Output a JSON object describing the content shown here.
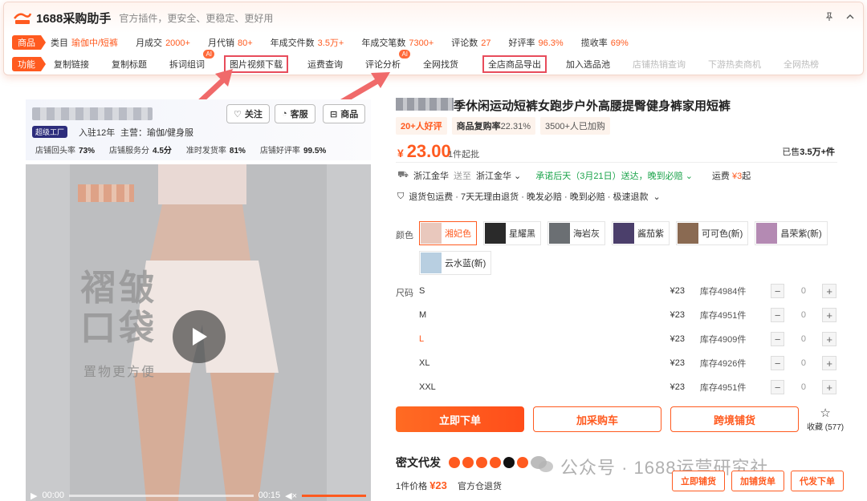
{
  "plugin": {
    "app_name": "1688采购助手",
    "tagline": "官方插件，更安全、更稳定、更好用",
    "row1_tag": "商品",
    "stats": [
      {
        "label": "类目",
        "value": "瑜伽中/短裤"
      },
      {
        "label": "月成交",
        "value": "2000+"
      },
      {
        "label": "月代销",
        "value": "80+"
      },
      {
        "label": "年成交件数",
        "value": "3.5万+"
      },
      {
        "label": "年成交笔数",
        "value": "7300+"
      },
      {
        "label": "评论数",
        "value": "27"
      },
      {
        "label": "好评率",
        "value": "96.3%"
      },
      {
        "label": "揽收率",
        "value": "69%"
      }
    ],
    "row2_tag": "功能",
    "functions": [
      {
        "label": "复制链接"
      },
      {
        "label": "复制标题"
      },
      {
        "label": "拆词组词",
        "ai": "AI"
      },
      {
        "label": "图片视频下载",
        "highlight": true
      },
      {
        "label": "运费查询"
      },
      {
        "label": "评论分析",
        "ai": "AI"
      },
      {
        "label": "全网找货"
      },
      {
        "label": "全店商品导出",
        "highlight": true
      },
      {
        "label": "加入选品池"
      },
      {
        "label": "店铺热销查询",
        "muted": true
      },
      {
        "label": "下游热卖商机",
        "muted": true
      },
      {
        "label": "全网热榜",
        "muted": true
      }
    ],
    "highlight_color": "#e84c5b"
  },
  "shop": {
    "follow_label": "关注",
    "service_label": "客服",
    "goods_label": "商品",
    "badge": "超级工厂",
    "years": "入驻12年",
    "main_business": "主营：瑜伽/健身服",
    "scores": [
      {
        "label": "店铺回头率",
        "value": "73%"
      },
      {
        "label": "店铺服务分",
        "value": "4.5分"
      },
      {
        "label": "准时发货率",
        "value": "81%"
      },
      {
        "label": "店铺好评率",
        "value": "99.5%"
      }
    ]
  },
  "video": {
    "overlay_line1": "褶皱",
    "overlay_line2": "口袋",
    "overlay_sub": "置物更方便",
    "time_current": "00:00",
    "time_total": "00:15"
  },
  "product": {
    "title": "季休闲运动短裤女跑步户外高腰提臀健身裤家用短裤",
    "chips": [
      {
        "text": "20+人好评",
        "style": "orange"
      },
      {
        "label": "商品复购率",
        "value": "22.31%"
      },
      {
        "text": "3500+人已加购"
      }
    ],
    "currency": "¥",
    "price": "23.00",
    "min_order": "1件起批",
    "sold_prefix": "已售",
    "sold_value": "3.5万+件",
    "ship_from": "浙江金华",
    "ship_to_label": "送至",
    "ship_to": "浙江金华",
    "promise": "承诺后天（3月21日）送达，晚到必赔",
    "fee_label": "运费",
    "fee_value": "¥3",
    "fee_suffix": "起",
    "services": "退货包运费 · 7天无理由退货 · 晚发必赔 · 晚到必赔 · 极速退款",
    "color_label": "颜色",
    "colors": [
      {
        "name": "湘妃色",
        "selected": true,
        "swatch": "#e9c8bd"
      },
      {
        "name": "星耀黑",
        "swatch": "#2a2a2a"
      },
      {
        "name": "海岩灰",
        "swatch": "#6b6f73"
      },
      {
        "name": "酱茄紫",
        "swatch": "#4b3f6b"
      },
      {
        "name": "可可色(新)",
        "swatch": "#8a6a52"
      },
      {
        "name": "昌荣紫(新)",
        "swatch": "#b48ab3"
      },
      {
        "name": "云水蓝(新)",
        "swatch": "#b8cfe1"
      }
    ],
    "size_label": "尺码",
    "sizes": [
      {
        "name": "S",
        "price": "¥23",
        "stock": "库存4984件",
        "qty": "0"
      },
      {
        "name": "M",
        "price": "¥23",
        "stock": "库存4951件",
        "qty": "0"
      },
      {
        "name": "L",
        "price": "¥23",
        "stock": "库存4909件",
        "qty": "0",
        "selected": true
      },
      {
        "name": "XL",
        "price": "¥23",
        "stock": "库存4926件",
        "qty": "0"
      },
      {
        "name": "XXL",
        "price": "¥23",
        "stock": "库存4951件",
        "qty": "0"
      }
    ],
    "buy_label": "立即下单",
    "cart_label": "加采购车",
    "cross_label": "跨境铺货",
    "fav_label": "收藏",
    "fav_count": "(577)"
  },
  "distribution": {
    "title": "密文代发",
    "unit_price_label": "1件价格",
    "unit_price": "¥23",
    "warehouse": "官方仓退货",
    "btn_list": "立即铺货",
    "btn_add": "加铺货单",
    "btn_order": "代发下单"
  },
  "watermark": "公众号 · 1688运营研究社",
  "brand_color": "#ff5a1f"
}
